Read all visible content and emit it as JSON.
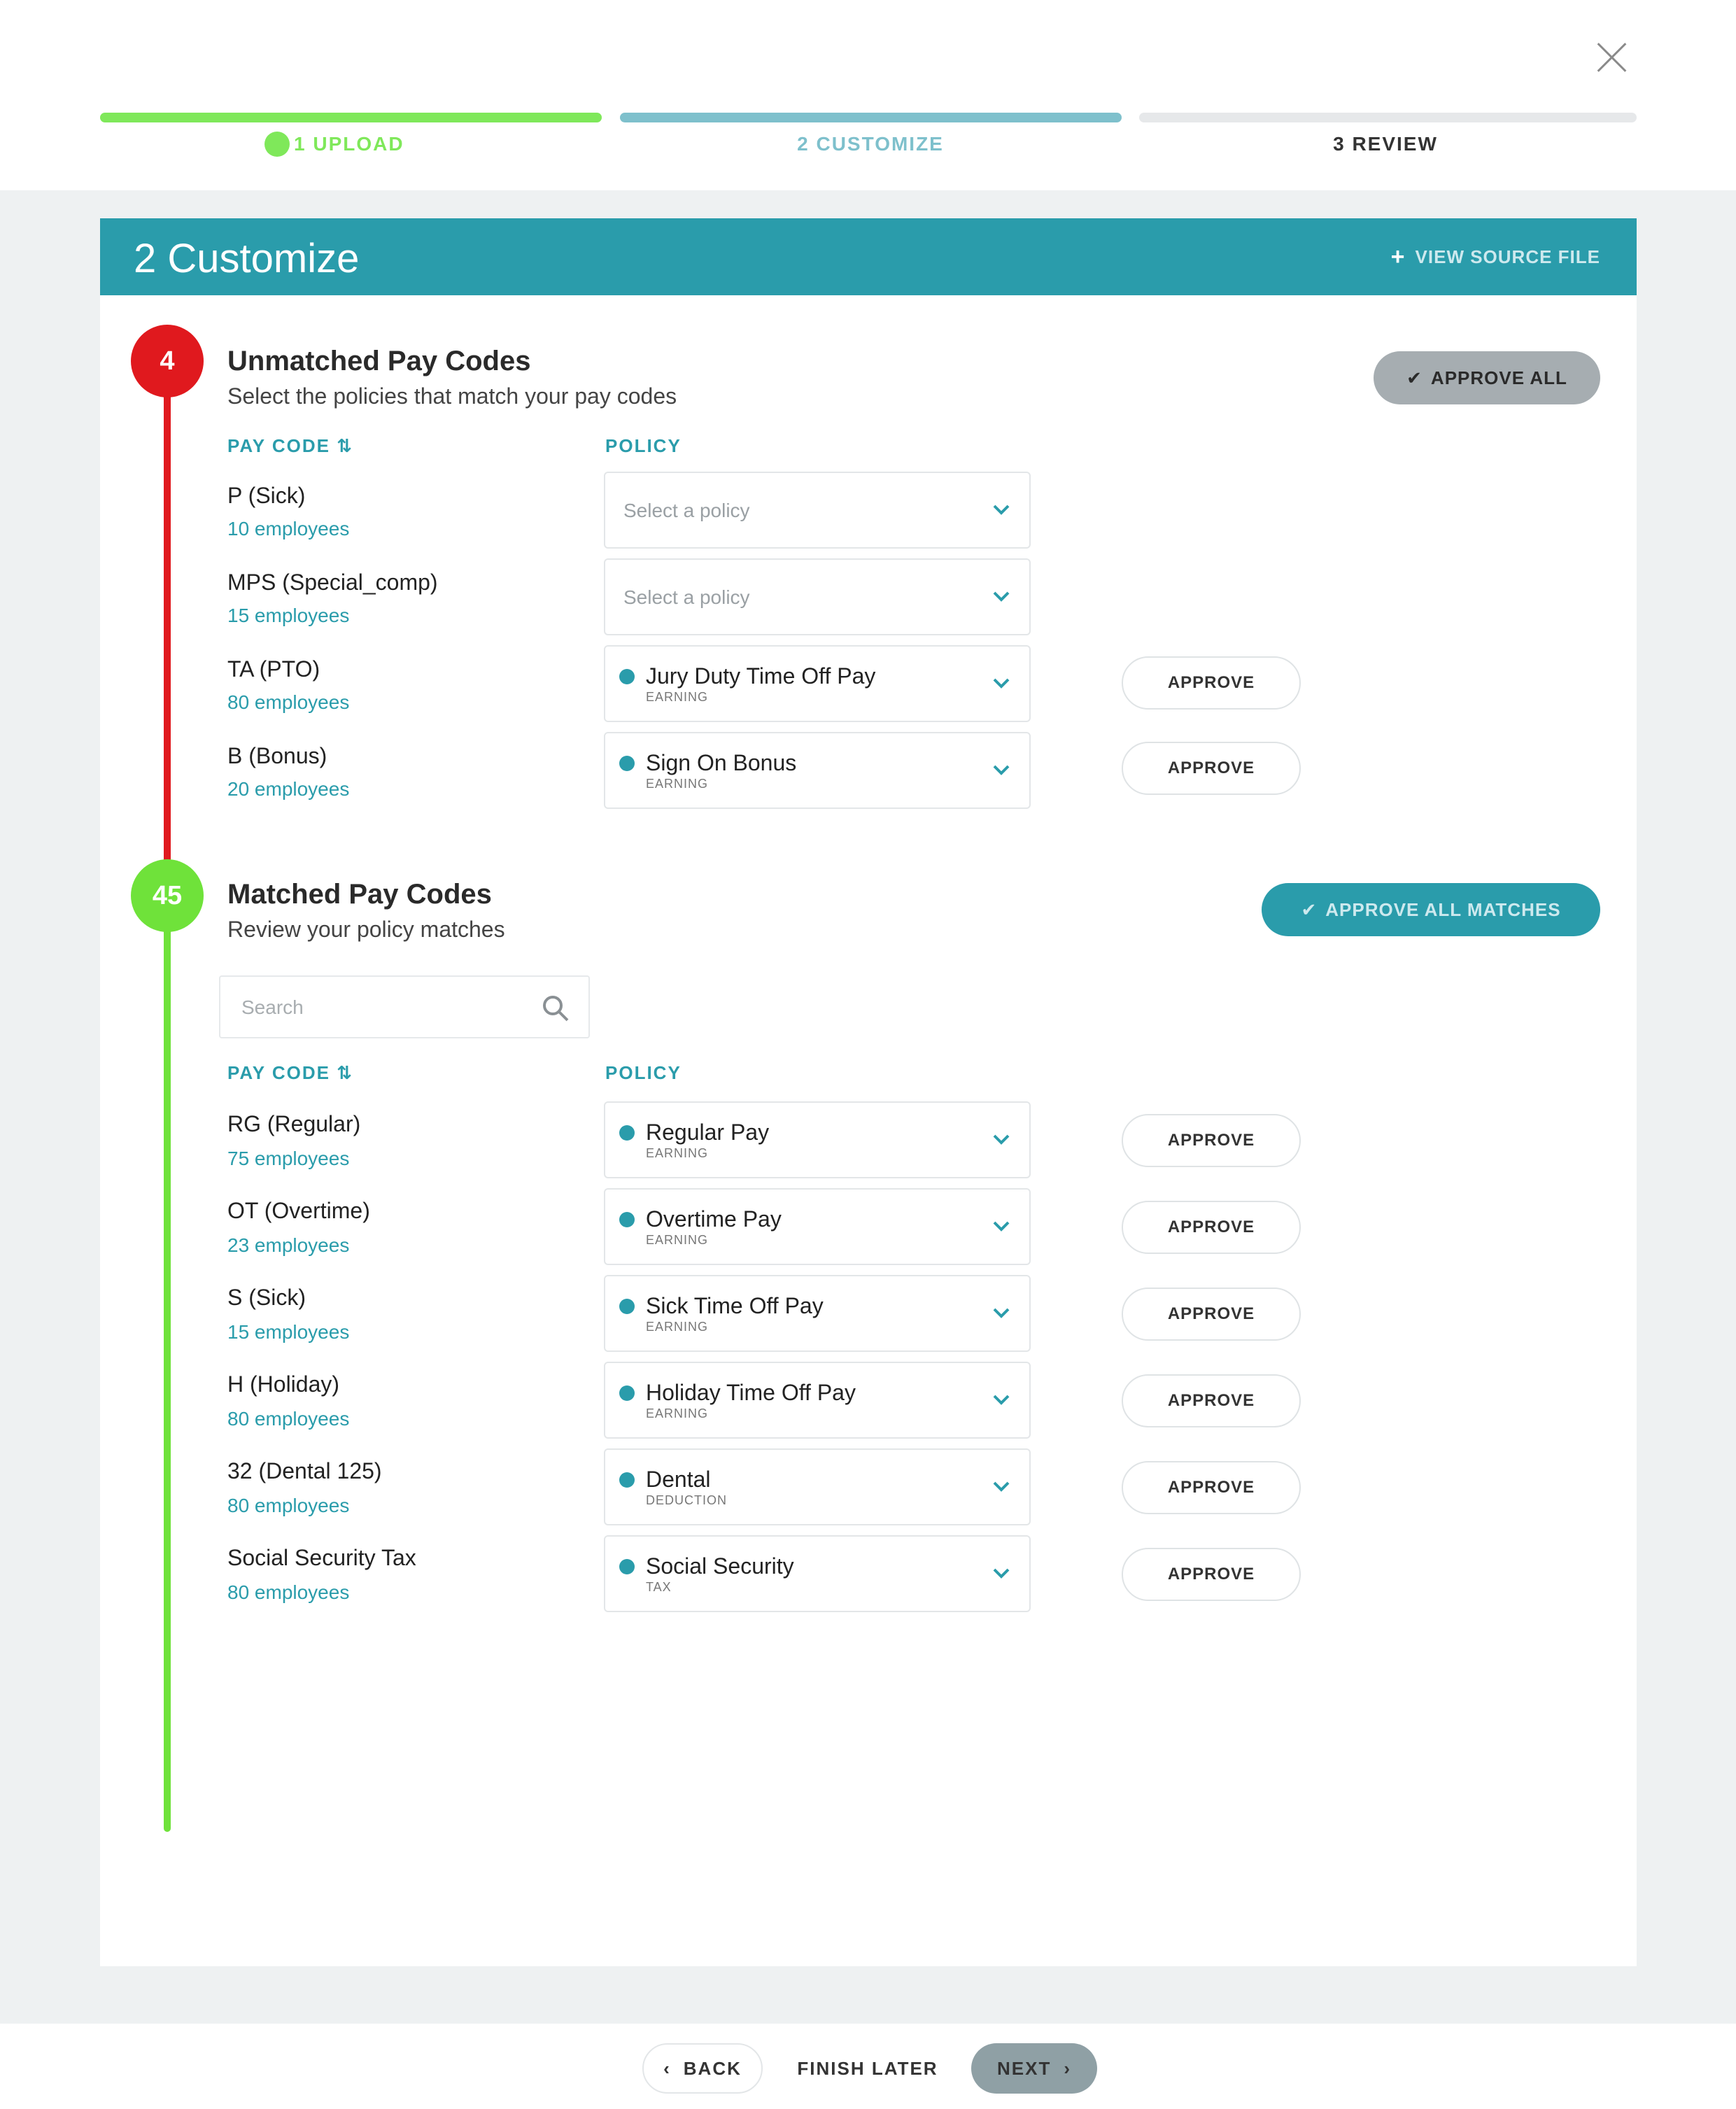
{
  "steps": [
    {
      "label": "1 UPLOAD",
      "color": "#7fe85a"
    },
    {
      "label": "2 CUSTOMIZE",
      "color": "#7ec0cc"
    },
    {
      "label": "3 REVIEW",
      "color": "#e6e8ea"
    }
  ],
  "header": {
    "title": "2 Customize",
    "source_link": "VIEW SOURCE FILE"
  },
  "unmatched": {
    "count": "4",
    "title": "Unmatched Pay Codes",
    "subtitle": "Select the policies that match your pay codes",
    "approve_all": "APPROVE ALL",
    "col_pay_code": "PAY CODE ⇅",
    "col_policy": "POLICY",
    "color": "#e0191e",
    "rows": [
      {
        "code": "P (Sick)",
        "employees": "10 employees",
        "placeholder": "Select a policy",
        "policy": "",
        "type": "",
        "approve": ""
      },
      {
        "code": "MPS (Special_comp)",
        "employees": "15 employees",
        "placeholder": "Select a policy",
        "policy": "",
        "type": "",
        "approve": ""
      },
      {
        "code": "TA (PTO)",
        "employees": "80 employees",
        "placeholder": "",
        "policy": "Jury Duty Time Off Pay",
        "type": "EARNING",
        "approve": "APPROVE"
      },
      {
        "code": "B (Bonus)",
        "employees": "20 employees",
        "placeholder": "",
        "policy": "Sign On Bonus",
        "type": "EARNING",
        "approve": "APPROVE"
      }
    ]
  },
  "matched": {
    "count": "45",
    "title": "Matched Pay Codes",
    "subtitle": "Review your policy matches",
    "approve_all": "APPROVE ALL MATCHES",
    "search_placeholder": "Search",
    "col_pay_code": "PAY CODE ⇅",
    "col_policy": "POLICY",
    "color": "#6fe23a",
    "rows": [
      {
        "code": "RG (Regular)",
        "employees": "75 employees",
        "policy": "Regular Pay",
        "type": "EARNING",
        "approve": "APPROVE"
      },
      {
        "code": "OT (Overtime)",
        "employees": "23 employees",
        "policy": "Overtime Pay",
        "type": "EARNING",
        "approve": "APPROVE"
      },
      {
        "code": "S (Sick)",
        "employees": "15 employees",
        "policy": "Sick Time Off Pay",
        "type": "EARNING",
        "approve": "APPROVE"
      },
      {
        "code": "H (Holiday)",
        "employees": "80 employees",
        "policy": "Holiday Time Off Pay",
        "type": "EARNING",
        "approve": "APPROVE"
      },
      {
        "code": "32 (Dental 125)",
        "employees": "80 employees",
        "policy": "Dental",
        "type": "DEDUCTION",
        "approve": "APPROVE"
      },
      {
        "code": "Social Security Tax",
        "employees": "80 employees",
        "policy": "Social Security",
        "type": "TAX",
        "approve": "APPROVE"
      }
    ]
  },
  "footer": {
    "back": "BACK",
    "finish_later": "FINISH LATER",
    "next": "NEXT"
  }
}
